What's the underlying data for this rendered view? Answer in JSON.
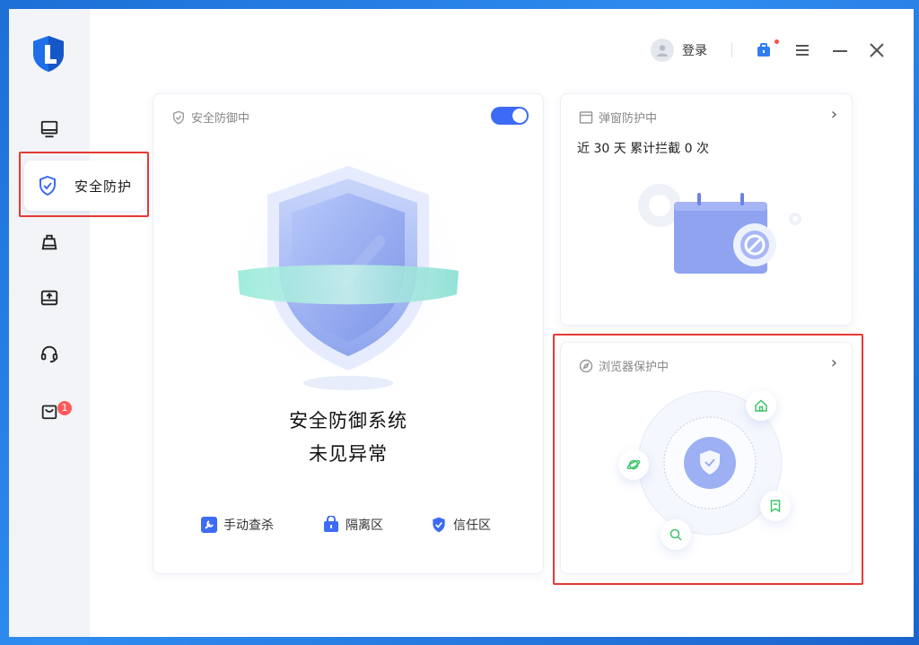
{
  "sidebar": {
    "items": [
      {
        "icon": "monitor-icon"
      },
      {
        "icon": "shield-check-icon",
        "label": "安全防护"
      },
      {
        "icon": "cleaning-icon"
      },
      {
        "icon": "tray-upload-icon"
      },
      {
        "icon": "headset-icon"
      },
      {
        "icon": "bag-icon",
        "badge": "1"
      }
    ]
  },
  "topbar": {
    "login_label": "登录"
  },
  "defense_card": {
    "title": "安全防御中",
    "toggle_on": true,
    "status_line1": "安全防御系统",
    "status_line2": "未见异常",
    "actions": [
      {
        "label": "手动查杀",
        "icon": "wrench-icon"
      },
      {
        "label": "隔离区",
        "icon": "lock-box-icon"
      },
      {
        "label": "信任区",
        "icon": "shield-check-icon"
      }
    ]
  },
  "popup_card": {
    "title": "弹窗防护中",
    "stat_text": "近 30 天 累计拦截 0 次"
  },
  "browser_card": {
    "title": "浏览器保护中"
  },
  "colors": {
    "accent": "#3d6bf5",
    "highlight": "#e53935",
    "orbit_icon": "#3cc46a"
  }
}
